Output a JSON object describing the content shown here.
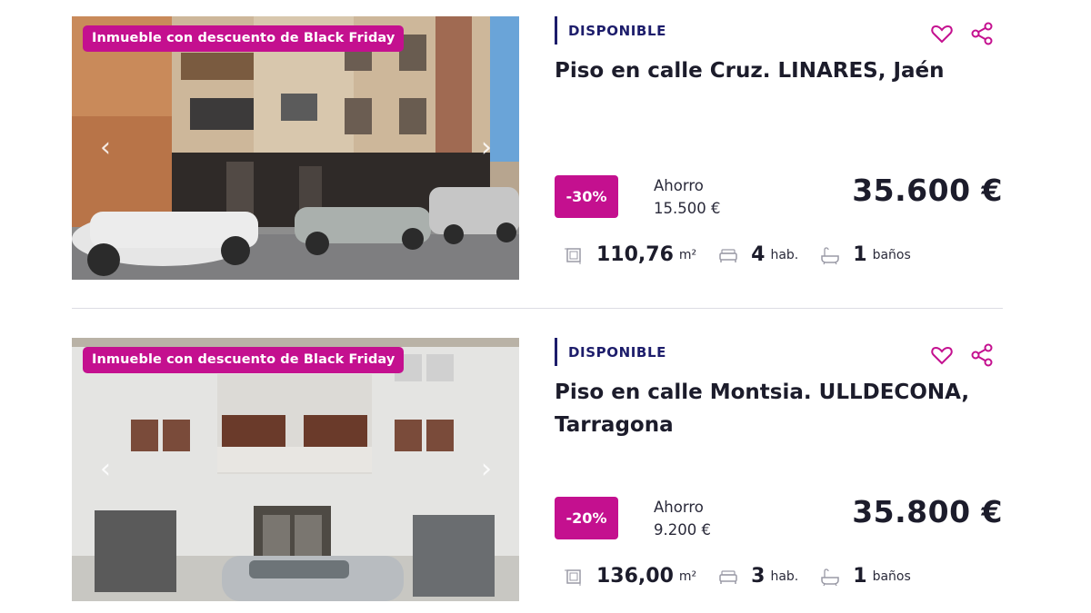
{
  "listings": [
    {
      "badge": "Inmueble con descuento de Black Friday",
      "status": "DISPONIBLE",
      "title": "Piso en calle Cruz. LINARES, Jaén",
      "discount": "-30%",
      "saving_label": "Ahorro",
      "saving_amount": "15.500 €",
      "price": "35.600 €",
      "area": "110,76",
      "area_unit": "m²",
      "rooms": "4",
      "rooms_unit": "hab.",
      "baths": "1",
      "baths_unit": "baños"
    },
    {
      "badge": "Inmueble con descuento de Black Friday",
      "status": "DISPONIBLE",
      "title": "Piso en calle Montsia. ULLDECONA, Tarragona",
      "discount": "-20%",
      "saving_label": "Ahorro",
      "saving_amount": "9.200 €",
      "price": "35.800 €",
      "area": "136,00",
      "area_unit": "m²",
      "rooms": "3",
      "rooms_unit": "hab.",
      "baths": "1",
      "baths_unit": "baños"
    }
  ],
  "icons": {
    "prev": "chevron-left-icon",
    "next": "chevron-right-icon",
    "favorite": "heart-icon",
    "share": "share-icon",
    "area": "floorplan-icon",
    "rooms": "bed-icon",
    "baths": "bathtub-icon"
  },
  "colors": {
    "accent": "#c4108f",
    "status": "#1d1d6b",
    "text": "#1c1c2b"
  }
}
